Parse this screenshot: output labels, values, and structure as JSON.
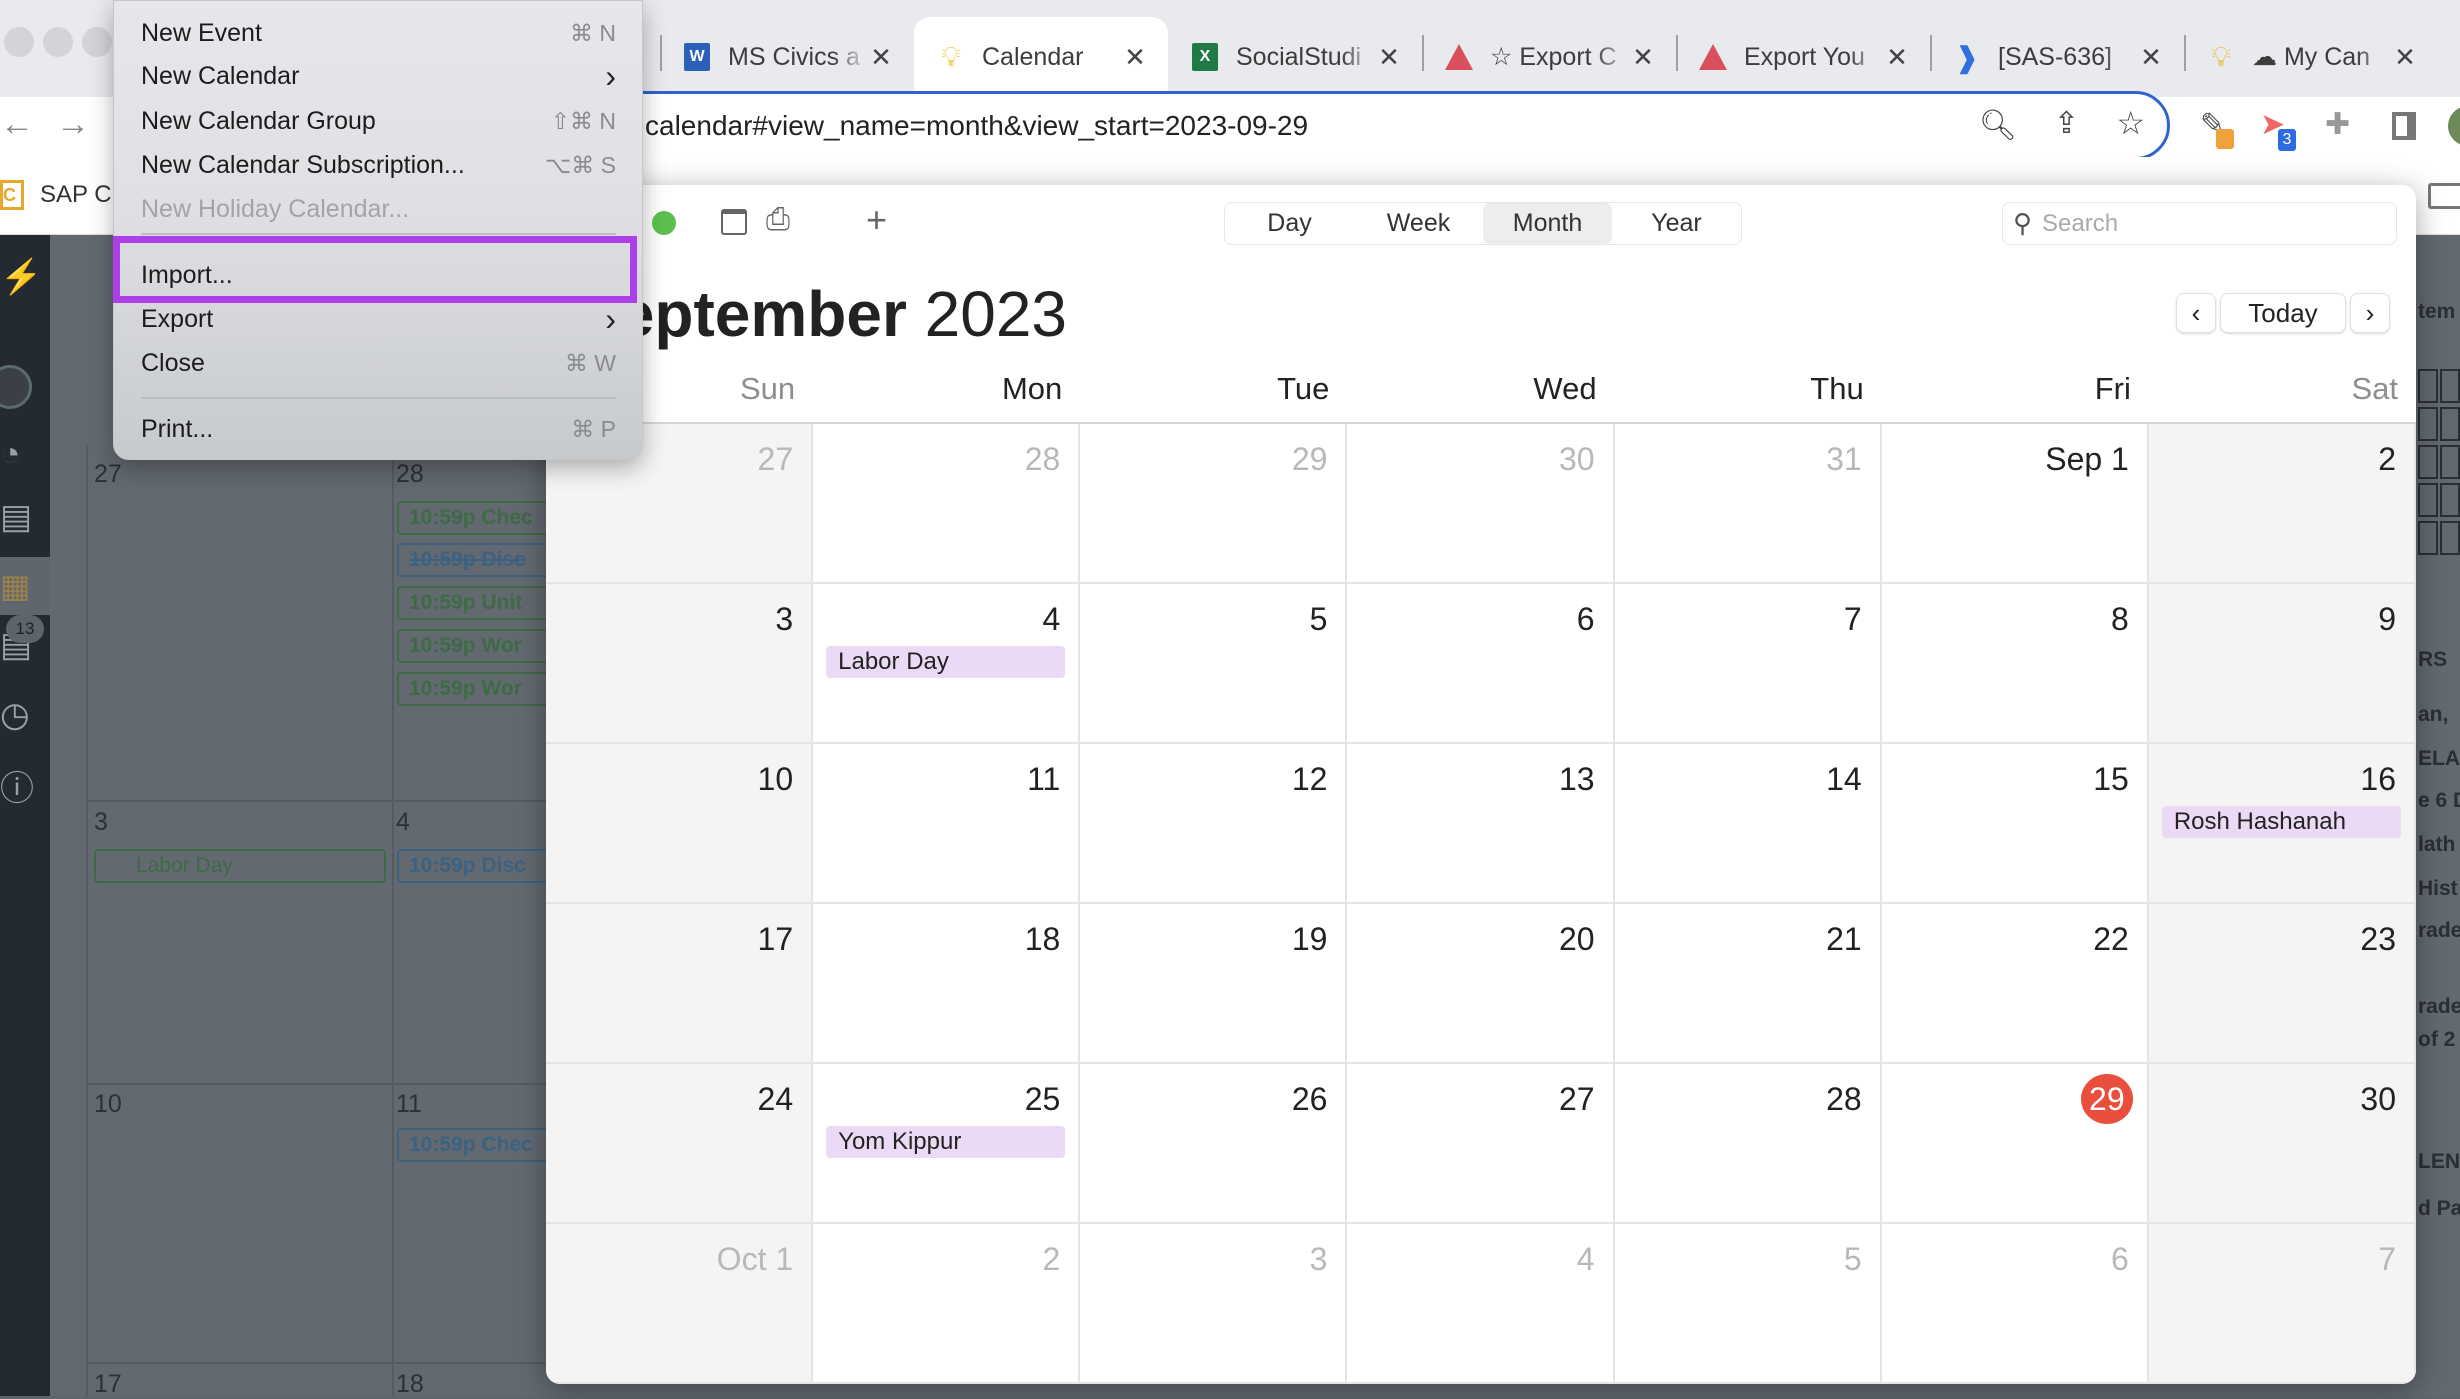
{
  "browser": {
    "tabs": [
      {
        "label": "MS Civics a",
        "icon": "word-icon"
      },
      {
        "label": "Calendar",
        "icon": "lightbulb-icon",
        "active": true
      },
      {
        "label": "SocialStudi",
        "icon": "excel-icon"
      },
      {
        "label": "☆ Export C",
        "icon": "triangle-logo-icon"
      },
      {
        "label": "Export You",
        "icon": "triangle-logo-icon"
      },
      {
        "label": "[SAS-636]",
        "icon": "jira-icon"
      },
      {
        "label": "☁ My Can",
        "icon": "lightbulb-icon"
      }
    ],
    "close_glyph": "✕",
    "url": "calendar#view_name=month&view_start=2023-09-29",
    "bookmark": "SAP C",
    "extension_badge": "3"
  },
  "menu": {
    "items": [
      {
        "label": "New Event",
        "shortcut": "⌘ N"
      },
      {
        "label": "New Calendar",
        "shortcut": "›"
      },
      {
        "label": "New Calendar Group",
        "shortcut": "⇧⌘ N"
      },
      {
        "label": "New Calendar Subscription...",
        "shortcut": "⌥⌘ S"
      },
      {
        "label": "New Holiday Calendar...",
        "shortcut": "",
        "disabled": true
      },
      {
        "label": "Import...",
        "shortcut": "",
        "highlighted": true
      },
      {
        "label": "Export",
        "shortcut": "›"
      },
      {
        "label": "Close",
        "shortcut": "⌘ W"
      },
      {
        "label": "Print...",
        "shortcut": "⌘ P"
      }
    ],
    "highlight_color": "#ad3fe6"
  },
  "calendar": {
    "views": [
      "Day",
      "Week",
      "Month",
      "Year"
    ],
    "active_view": "Month",
    "search_placeholder": "Search",
    "title_month": "September",
    "title_year": "2023",
    "prev": "‹",
    "today_label": "Today",
    "next": "›",
    "weekdays": [
      "Sun",
      "Mon",
      "Tue",
      "Wed",
      "Thu",
      "Fri",
      "Sat"
    ],
    "weeks": [
      [
        {
          "d": "27",
          "m": true
        },
        {
          "d": "28",
          "m": true
        },
        {
          "d": "29",
          "m": true
        },
        {
          "d": "30",
          "m": true
        },
        {
          "d": "31",
          "m": true
        },
        {
          "d": "Sep 1"
        },
        {
          "d": "2"
        }
      ],
      [
        {
          "d": "3"
        },
        {
          "d": "4",
          "ev": "Labor Day"
        },
        {
          "d": "5"
        },
        {
          "d": "6"
        },
        {
          "d": "7"
        },
        {
          "d": "8"
        },
        {
          "d": "9"
        }
      ],
      [
        {
          "d": "10"
        },
        {
          "d": "11"
        },
        {
          "d": "12"
        },
        {
          "d": "13"
        },
        {
          "d": "14"
        },
        {
          "d": "15"
        },
        {
          "d": "16",
          "ev": "Rosh Hashanah"
        }
      ],
      [
        {
          "d": "17"
        },
        {
          "d": "18"
        },
        {
          "d": "19"
        },
        {
          "d": "20"
        },
        {
          "d": "21"
        },
        {
          "d": "22"
        },
        {
          "d": "23"
        }
      ],
      [
        {
          "d": "24"
        },
        {
          "d": "25",
          "ev": "Yom Kippur"
        },
        {
          "d": "26"
        },
        {
          "d": "27"
        },
        {
          "d": "28"
        },
        {
          "d": "29",
          "today": true
        },
        {
          "d": "30"
        }
      ],
      [
        {
          "d": "Oct 1",
          "m": true
        },
        {
          "d": "2",
          "m": true
        },
        {
          "d": "3",
          "m": true
        },
        {
          "d": "4",
          "m": true
        },
        {
          "d": "5",
          "m": true
        },
        {
          "d": "6",
          "m": true
        },
        {
          "d": "7",
          "m": true
        }
      ]
    ],
    "today_color": "#ea4e3d",
    "event_color": "#ecd9f5"
  },
  "background_page": {
    "badge": "13",
    "days": [
      "27",
      "28",
      "3",
      "4",
      "10",
      "11",
      "17",
      "18"
    ],
    "events_28": [
      "10:59p Chec",
      "10:59p Disc",
      "10:59p Unit",
      "10:59p Wor",
      "10:59p Wor"
    ],
    "event_3": "Labor Day",
    "event_4": "10:59p Disc",
    "event_11": "10:59p Chec",
    "right_fragments": [
      "tem",
      "RS",
      "an,",
      "ELA",
      "e 6 D",
      "lath I",
      "Hist",
      "rade",
      "rade",
      "of 2",
      "LEN",
      "d Pa"
    ]
  }
}
